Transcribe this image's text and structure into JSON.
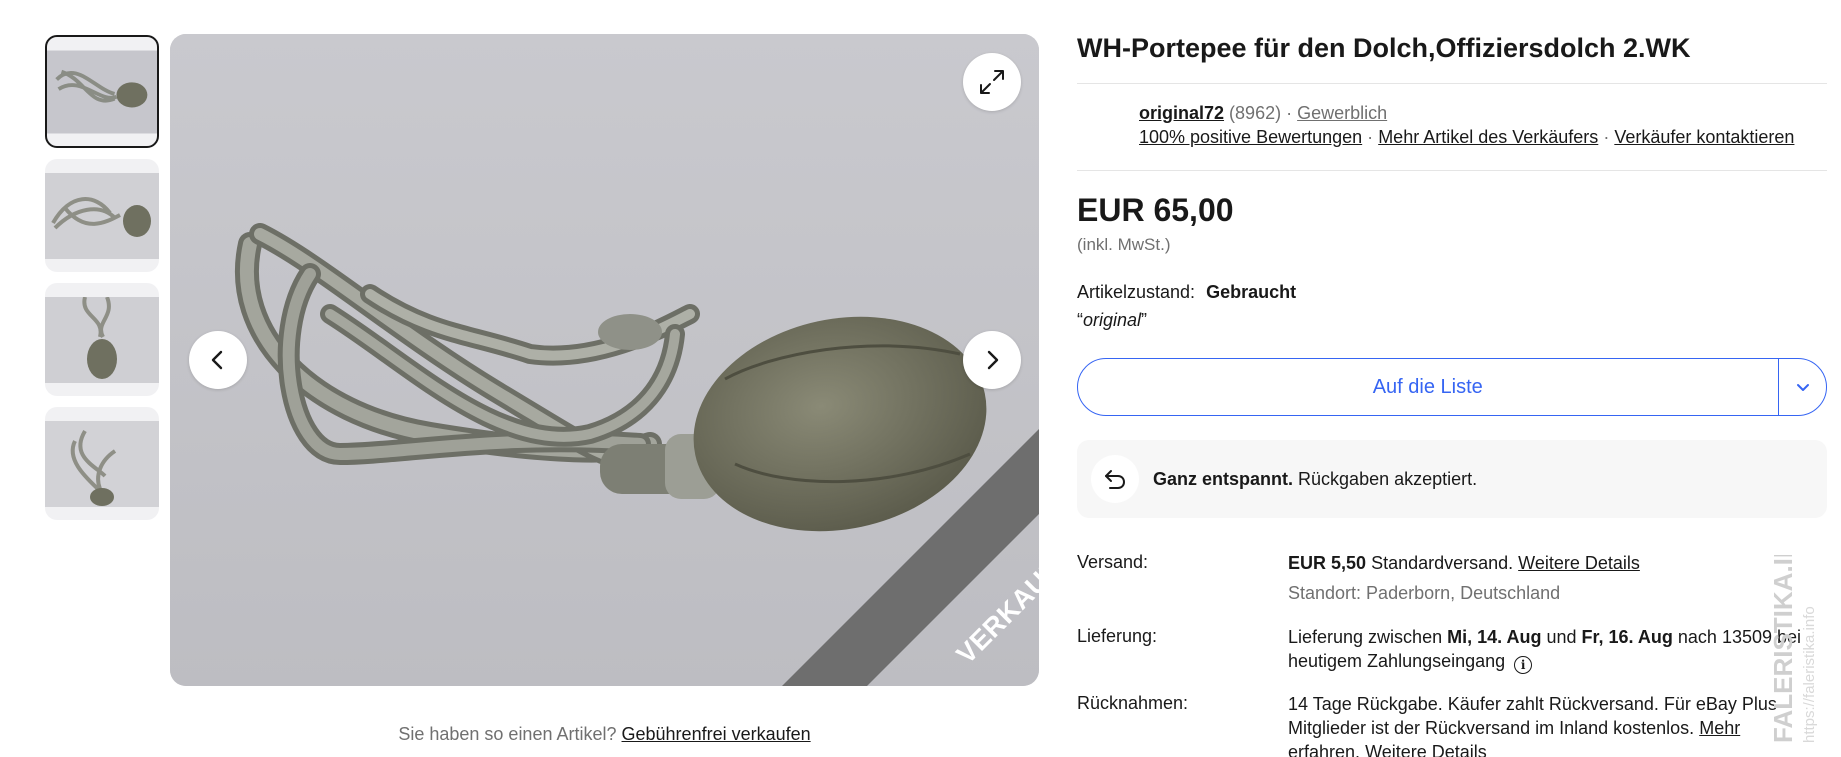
{
  "thumbnails": [
    {
      "name": "thumbnail-1",
      "active": true
    },
    {
      "name": "thumbnail-2",
      "active": false
    },
    {
      "name": "thumbnail-3",
      "active": false
    },
    {
      "name": "thumbnail-4",
      "active": false
    }
  ],
  "gallery": {
    "sold_label": "VERKAUFT",
    "expand_icon": "expand-icon",
    "prev_icon": "chevron-left-icon",
    "next_icon": "chevron-right-icon"
  },
  "sell_prompt": {
    "text": "Sie haben so einen Artikel?",
    "link": "Gebührenfrei verkaufen"
  },
  "item": {
    "title": "WH-Portepee für den Dolch,Offiziersdolch 2.WK",
    "price": "EUR 65,00",
    "tax_note": "(inkl. MwSt.)",
    "condition_label": "Artikelzustand:",
    "condition_value": "Gebraucht",
    "condition_note_open": "“",
    "condition_note": "original",
    "condition_note_close": "”"
  },
  "seller": {
    "name": "original72",
    "rating_count": "(8962)",
    "separator": "·",
    "type": "Gewerblich",
    "positive": "100% positive Bewertungen",
    "more_items": "Mehr Artikel des Verkäufers",
    "contact": "Verkäufer kontaktieren"
  },
  "watchlist": {
    "label": "Auf die Liste",
    "dropdown_icon": "chevron-down-icon"
  },
  "returns_banner": {
    "icon": "return-arrow-icon",
    "bold": "Ganz entspannt.",
    "text": "Rückgaben akzeptiert."
  },
  "shipping": {
    "label": "Versand:",
    "cost": "EUR 5,50",
    "method": "Standardversand.",
    "details_link": "Weitere Details",
    "location": "Standort: Paderborn, Deutschland"
  },
  "delivery": {
    "label": "Lieferung:",
    "prefix": "Lieferung zwischen",
    "from": "Mi, 14. Aug",
    "and": "und",
    "to": "Fr, 16. Aug",
    "suffix": "nach 13509 bei heutigem Zahlungseingang",
    "info_icon": "info-icon"
  },
  "returns": {
    "label": "Rücknahmen:",
    "text": "14 Tage Rückgabe. Käufer zahlt Rückversand. Für eBay Plus-Mitglieder ist der Rückversand im Inland kostenlos.",
    "more_link": "Mehr erfahren",
    "period": ".",
    "details_link": "Weitere Details"
  },
  "watermark": {
    "line1": "FALERISTIKA.INFO",
    "line2": "https://faleristika.info"
  },
  "colors": {
    "accent": "#3665f3",
    "text": "#191919",
    "muted": "#707070",
    "ribbon": "#6e6e6e"
  }
}
